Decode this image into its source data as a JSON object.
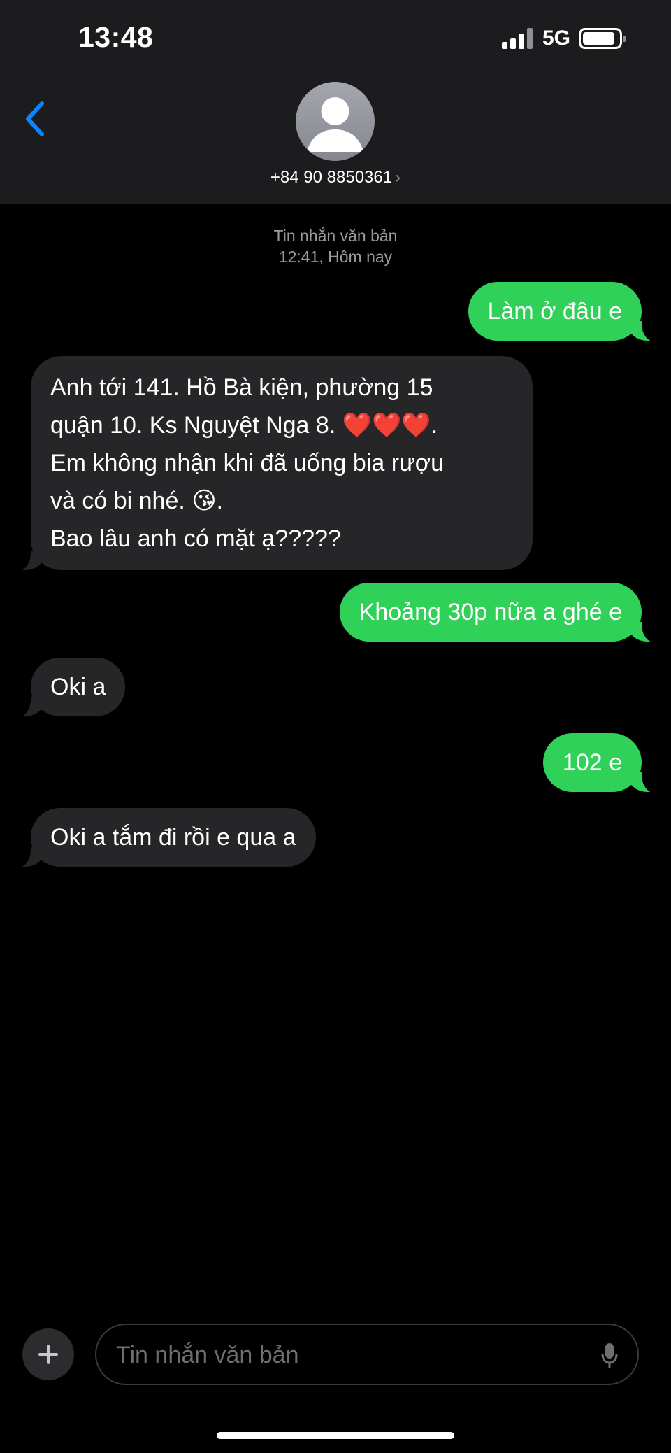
{
  "status_bar": {
    "time": "13:48",
    "network": "5G"
  },
  "header": {
    "contact_number": "+84 90 8850361",
    "chevron": "›"
  },
  "conversation": {
    "meta_type": "Tin nhắn văn bản",
    "meta_time": "12:41, Hôm nay",
    "messages": [
      {
        "direction": "outgoing",
        "text": "Làm ở đâu e"
      },
      {
        "direction": "incoming",
        "lines": [
          "Anh tới 141. Hồ Bà kiện, phường 15",
          "quận 10. Ks Nguyệt Nga   8. ❤️❤️❤️.",
          "Em không nhận khi đã uống bia rượu",
          "và có bi nhé. 😘.",
          "Bao lâu anh có mặt ạ?????"
        ]
      },
      {
        "direction": "outgoing",
        "text": "Khoảng 30p nữa a ghé e"
      },
      {
        "direction": "incoming",
        "text": "Oki a"
      },
      {
        "direction": "outgoing",
        "text": "102 e"
      },
      {
        "direction": "incoming",
        "text": "Oki a tắm đi rồi e qua a"
      }
    ]
  },
  "composer": {
    "placeholder": "Tin nhắn văn bản"
  },
  "icons": {
    "back": "chevron-left-icon",
    "plus": "plus-icon",
    "mic": "microphone-icon",
    "avatar": "person-icon"
  },
  "colors": {
    "outgoing_bubble": "#30d158",
    "incoming_bubble": "#262628",
    "accent": "#0a84ff"
  }
}
